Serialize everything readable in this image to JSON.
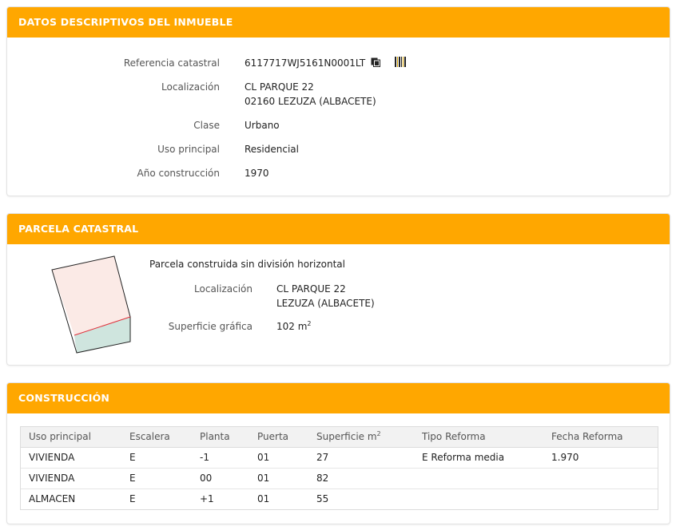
{
  "inmueble": {
    "header": "DATOS DESCRIPTIVOS DEL INMUEBLE",
    "referencia_label": "Referencia catastral",
    "referencia_value": "6117717WJ5161N0001LT",
    "localizacion_label": "Localización",
    "localizacion_line1": "CL PARQUE 22",
    "localizacion_line2": "02160 LEZUZA (ALBACETE)",
    "clase_label": "Clase",
    "clase_value": "Urbano",
    "uso_label": "Uso principal",
    "uso_value": "Residencial",
    "anio_label": "Año construcción",
    "anio_value": "1970",
    "icons": [
      "copy-icon",
      "barcode-icon"
    ]
  },
  "parcela": {
    "header": "PARCELA CATASTRAL",
    "descripcion": "Parcela construida sin división horizontal",
    "localizacion_label": "Localización",
    "localizacion_line1": "CL PARQUE 22",
    "localizacion_line2": "LEZUZA (ALBACETE)",
    "superficie_label": "Superficie gráfica",
    "superficie_value": "102 m",
    "superficie_unit_sup": "2",
    "plot_colors": {
      "building": "#fbeae6",
      "yard": "#cfe5de",
      "divider": "#e0303a",
      "outline": "#222222"
    }
  },
  "construccion": {
    "header": "CONSTRUCCIÓN",
    "columns": [
      "Uso principal",
      "Escalera",
      "Planta",
      "Puerta",
      "Superficie m",
      "Tipo Reforma",
      "Fecha Reforma"
    ],
    "superficie_col_sup": "2",
    "rows": [
      [
        "VIVIENDA",
        "E",
        "-1",
        "01",
        "27",
        "E Reforma media",
        "1.970"
      ],
      [
        "VIVIENDA",
        "E",
        "00",
        "01",
        "82",
        "",
        ""
      ],
      [
        "ALMACEN",
        "E",
        "+1",
        "01",
        "55",
        "",
        ""
      ]
    ]
  },
  "colors": {
    "accent": "#ffa700"
  }
}
